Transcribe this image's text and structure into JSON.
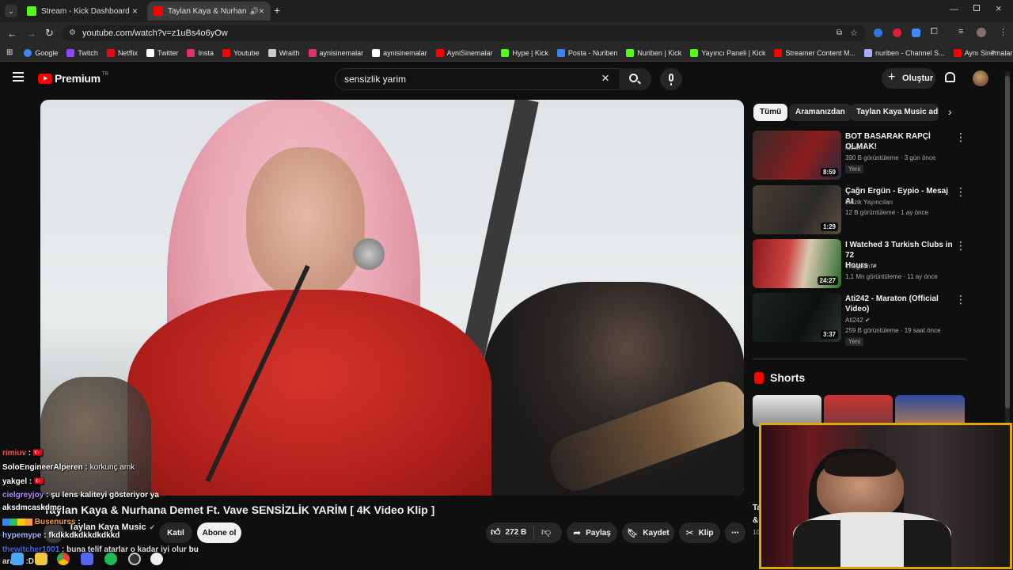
{
  "browser": {
    "tabs": [
      {
        "title": "Stream - Kick Dashboard",
        "favicon_color": "#53fc18",
        "active": false
      },
      {
        "title": "Taylan Kaya & Nurhana Dem",
        "favicon_color": "#ff0000",
        "active": true
      }
    ],
    "url": "youtube.com/watch?v=z1uBs4o6yOw",
    "bookmarks": [
      {
        "label": "Google",
        "icon": "google-icon",
        "color": "#4285f4"
      },
      {
        "label": "Twitch",
        "icon": "twitch-icon",
        "color": "#9146ff"
      },
      {
        "label": "Netflix",
        "icon": "netflix-icon",
        "color": "#e50914"
      },
      {
        "label": "Twitter",
        "icon": "x-icon",
        "color": "#ffffff"
      },
      {
        "label": "Insta",
        "icon": "instagram-icon",
        "color": "#e1306c"
      },
      {
        "label": "Youtube",
        "icon": "youtube-icon",
        "color": "#ff0000"
      },
      {
        "label": "Wraith",
        "icon": "wraith-icon",
        "color": "#cccccc"
      },
      {
        "label": "aynisinemalar",
        "icon": "instagram-icon",
        "color": "#e1306c"
      },
      {
        "label": "aynisinemalar",
        "icon": "x-icon",
        "color": "#ffffff"
      },
      {
        "label": "AyniSinemalar",
        "icon": "youtube-icon",
        "color": "#ff0000"
      },
      {
        "label": "Hype | Kick",
        "icon": "kick-icon",
        "color": "#53fc18"
      },
      {
        "label": "Posta - Nuriben",
        "icon": "mail-icon",
        "color": "#3b82f6"
      },
      {
        "label": "Nuriben | Kick",
        "icon": "kick-icon",
        "color": "#53fc18"
      },
      {
        "label": "Yayıncı Paneli | Kick",
        "icon": "kick-icon",
        "color": "#53fc18"
      },
      {
        "label": "Streamer Content M...",
        "icon": "youtube-icon",
        "color": "#ff0000"
      },
      {
        "label": "nuriben - Channel S...",
        "icon": "youtube-studio-icon",
        "color": "#aaaaff"
      },
      {
        "label": "Aynı Sinemalar - Ça...",
        "icon": "youtube-icon",
        "color": "#ff0000"
      }
    ]
  },
  "youtube": {
    "logo_text": "Premium",
    "logo_badge": "TR",
    "search_query": "sensizlik yarim",
    "create_label": "Oluştur",
    "video": {
      "title": "Taylan Kaya & Nurhana Demet Ft. Vave SENSİZLİK YARİM [ 4K Video Klip ]",
      "channel": "Taylan Kaya Music",
      "join_label": "Katıl",
      "subscribe_label": "Abone ol",
      "likes": "272 B",
      "share_label": "Paylaş",
      "save_label": "Kaydet",
      "clip_label": "Klip"
    },
    "filter_chips": [
      "Tümü",
      "Aramanızdan",
      "Taylan Kaya Music adlı y"
    ],
    "recommendations": [
      {
        "title_lines": [
          "BOT BASARAK RAPÇİ OLMAK!"
        ],
        "channel": "luther",
        "verified": true,
        "meta": "390 B görüntüleme · 3 gün önce",
        "badge": "Yeni",
        "duration": "8:59",
        "thumb_colors": [
          "#3a2a2a",
          "#8a1d1d"
        ]
      },
      {
        "title_lines": [
          "Çağrı Ergün - Eypio - Mesaj At"
        ],
        "channel": "Müzik Yayıncıları",
        "verified": false,
        "meta": "12 B görüntüleme · 1 ay önce",
        "badge": "",
        "duration": "1:29",
        "thumb_colors": [
          "#4a3f33",
          "#2b2a28"
        ]
      },
      {
        "title_lines": [
          "I Watched 3 Turkish Clubs in 72",
          "Hours"
        ],
        "title_suffix": "TR",
        "channel": "Thogden",
        "verified": true,
        "meta": "1,1 Mn görüntüleme · 11 ay önce",
        "badge": "",
        "duration": "24:27",
        "thumb_colors": [
          "#8a1a1a",
          "#2f6b2f"
        ]
      },
      {
        "title_lines": [
          "Ati242 - Maraton (Official",
          "Video)"
        ],
        "channel": "Ati242",
        "verified": true,
        "meta": "259 B görüntüleme · 19 saat önce",
        "badge": "Yeni",
        "duration": "3:37",
        "thumb_colors": [
          "#1d2424",
          "#0d1111"
        ]
      }
    ],
    "shorts_label": "Shorts",
    "partial_items": [
      "Ta",
      "&",
      "10"
    ]
  },
  "chat": [
    {
      "user": "rimiuv",
      "user_color": "#ff4d4d",
      "text": "🇹🇷"
    },
    {
      "user": "SoloEngineerAlperen",
      "user_color": "#ffffff",
      "text": "korkunç amk"
    },
    {
      "user": "yakgel",
      "user_color": "#ffffff",
      "text": "🇹🇷"
    },
    {
      "user": "cielgreyjoy",
      "user_color": "#b48cff",
      "text": "şu lens kaliteyi gösteriyor ya"
    },
    {
      "user": "",
      "user_color": "#ffffff",
      "text": "aksdmcaskdmc"
    },
    {
      "user": "Busenurss",
      "user_color": "#ff9a3c",
      "text": ""
    },
    {
      "user": "hypemype",
      "user_color": "#9fb4ff",
      "text": "fkdkkdkdkkdkdkkd"
    },
    {
      "user": "thewitcher1001",
      "user_color": "#4d7bff",
      "text": "buna telif atarlar o kadar iyi olur bu"
    },
    {
      "user": "",
      "user_color": "#ffffff",
      "text": "arada :D"
    }
  ]
}
